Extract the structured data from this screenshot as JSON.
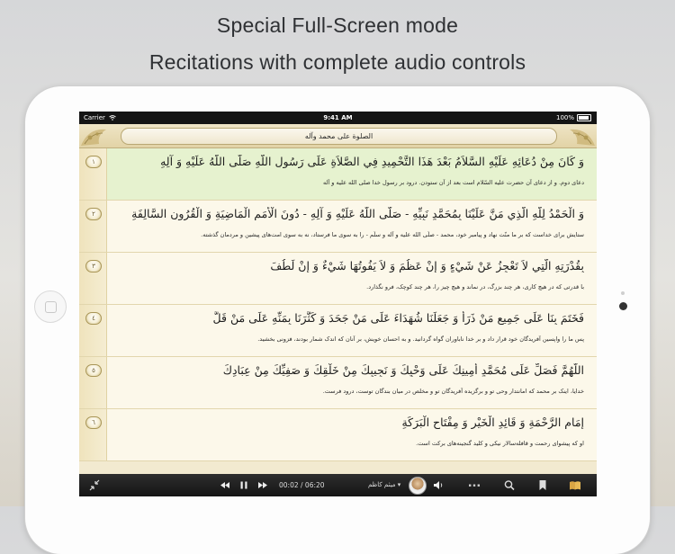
{
  "promo": {
    "line1": "Special Full-Screen mode",
    "line2": "Recitations with complete audio controls"
  },
  "status_bar": {
    "carrier": "Carrier",
    "time": "9:41 AM",
    "battery": "100%"
  },
  "header": {
    "title": "الصلوة على محمد وآله"
  },
  "verses": [
    {
      "number": "١",
      "arabic": "وَ كَانَ مِنْ دُعَائِهِ عَلَيْهِ السَّلاَمُ بَعْدَ هَذَا التَّحْمِيدِ فِي الصَّلاَةِ عَلَى رَسُولِ اللَّهِ صَلَّى اللَّهُ عَلَيْهِ وَ آلِهِ",
      "translation": "دعای دوم. و از دعای آن حضرت علیه السّلام است بعد از آن ستودن. درود بر رسول خدا صلی الله علیه و آله",
      "active": true
    },
    {
      "number": "٢",
      "arabic": "وَ الْحَمْدُ لِلَّهِ الَّذِي مَنَّ عَلَيْنَا بِمُحَمَّدٍ نَبِيِّهِ - صَلَّى اللَّهُ عَلَيْهِ وَ آلِهِ - دُونَ الْأُمَمِ الْمَاضِيَةِ وَ الْقُرُونِ السَّالِفَةِ",
      "translation": "ستایش برای خداست که بر ما منّت نهاد و پیامبر خود، محمد - صلّی الله علیه و آله و سلّم - را به سوی ما فرستاد، نه به سوی امت‌های پیشین و مردمان گذشته.",
      "active": false
    },
    {
      "number": "٣",
      "arabic": "بِقُدْرَتِهِ الَّتِي لاَ تَعْجِزُ عَنْ شَيْءٍ وَ إِنْ عَظُمَ وَ لاَ يَفُوتُهَا شَيْءٌ وَ إِنْ لَطُفَ",
      "translation": "با قدرتی که در هیچ کاری، هر چند بزرگ، در نماند و هیچ چیز را، هر چند کوچک، فرو نگذارد.",
      "active": false
    },
    {
      "number": "٤",
      "arabic": "فَخَتَمَ بِنَا عَلَى جَمِيعِ مَنْ ذَرَأَ وَ جَعَلَنَا شُهَدَاءَ عَلَى مَنْ جَحَدَ وَ كَثَّرَنَا بِمَنِّهِ عَلَى مَنْ قَلَّ",
      "translation": "پس ما را واپسین آفریدگان خود قرار داد و بر خدا ناباوران گواه گردانید. و به احسان خویش، بر آنان که اندک شمار بودند، فزونی بخشید.",
      "active": false
    },
    {
      "number": "٥",
      "arabic": "اللَّهُمَّ فَصَلِّ عَلَى مُحَمَّدٍ أَمِينِكَ عَلَى وَحْيِكَ وَ نَجِيبِكَ مِنْ خَلْقِكَ وَ صَفِيِّكَ مِنْ عِبَادِكَ",
      "translation": "خدایا، اینک بر محمد که امانتدار وحی تو و برگزیده آفریدگان تو و مخلص در میان بندگان توست، درود فرست.",
      "active": false
    },
    {
      "number": "٦",
      "arabic": "إِمَامِ الرَّحْمَةِ وَ قَائِدِ الْخَيْرِ وَ مِفْتَاحِ الْبَرَكَةِ",
      "translation": "او که پیشوای رحمت و قافله‌سالار نیکی و کلید گنجینه‌های برکت است.",
      "active": false
    }
  ],
  "player": {
    "elapsed": "00:02",
    "duration": "06:20",
    "time_separator": " / ",
    "reciter": "میثم کاظم"
  },
  "icons": {
    "exit_fullscreen": "collapse-arrows-icon",
    "rewind": "rewind-icon",
    "pause": "pause-icon",
    "forward": "fast-forward-icon",
    "volume": "speaker-icon",
    "more": "more-dots-icon",
    "search": "search-icon",
    "bookmark": "bookmark-icon",
    "book": "open-book-icon"
  },
  "colors": {
    "active_verse": "#e6f2cf",
    "verse_background": "#fcf8ea",
    "header": "#e2d3a6",
    "player": "#1e1e1e"
  }
}
